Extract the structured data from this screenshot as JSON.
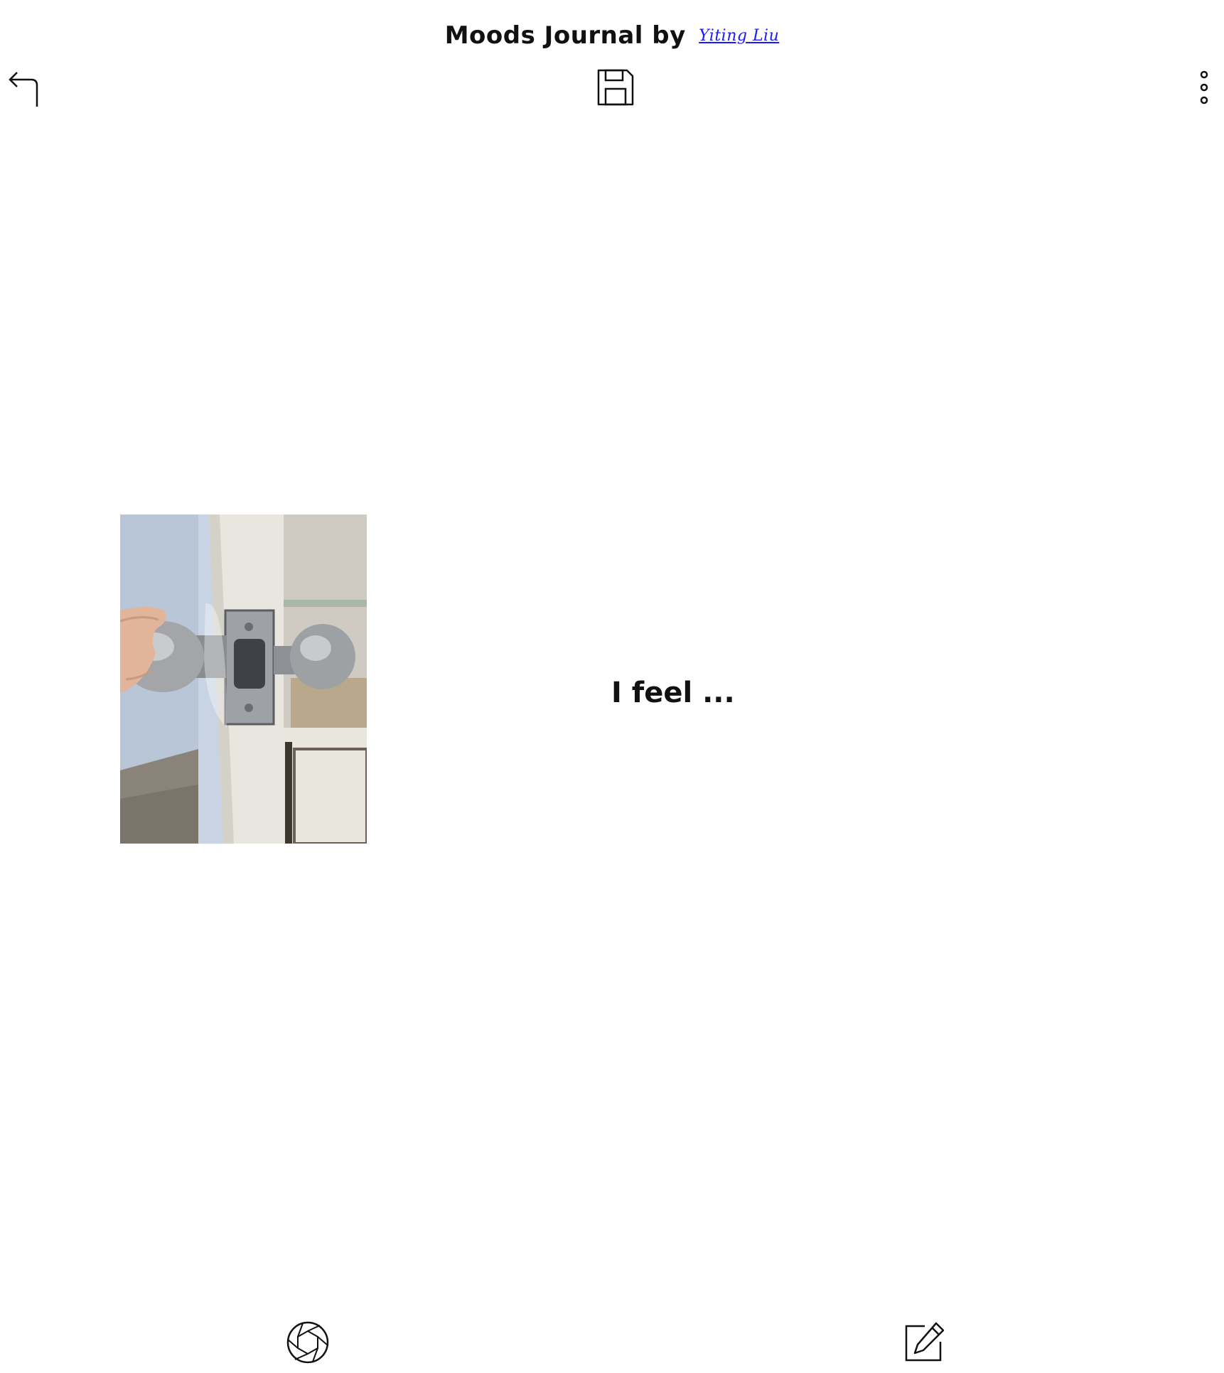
{
  "header": {
    "title": "Moods Journal by",
    "author_link": "Yiting Liu"
  },
  "toolbar": {
    "back_icon": "back-arrow-icon",
    "save_icon": "floppy-save-icon",
    "more_icon": "more-vertical-icon"
  },
  "entry": {
    "photo_description_icon": "door-knob-photo",
    "prompt_text": "I feel ..."
  },
  "bottom_bar": {
    "camera_icon": "camera-aperture-icon",
    "edit_icon": "edit-note-icon"
  },
  "colors": {
    "background": "#ffffff",
    "text": "#111111",
    "link": "#1a1aff"
  }
}
